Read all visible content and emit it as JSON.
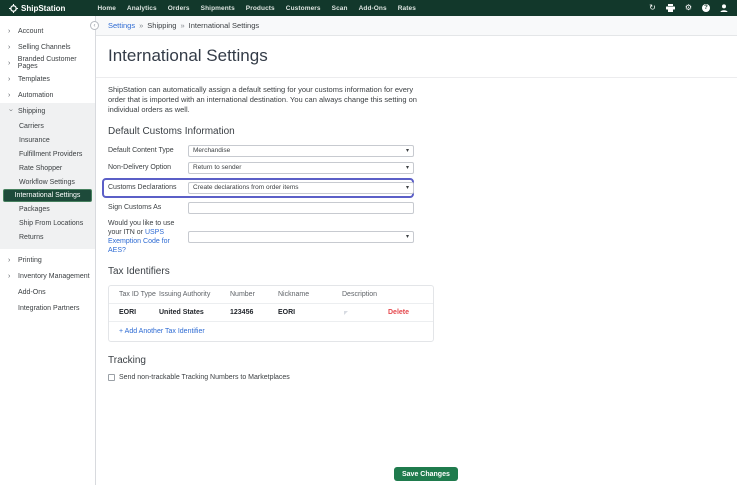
{
  "topbar": {
    "brand": "ShipStation",
    "nav": [
      "Home",
      "Analytics",
      "Orders",
      "Shipments",
      "Products",
      "Customers",
      "Scan",
      "Add-Ons",
      "Rates"
    ]
  },
  "breadcrumb": {
    "separator": "»",
    "settings": "Settings",
    "shipping": "Shipping",
    "current": "International Settings"
  },
  "sidebar": {
    "items_top": [
      "Account",
      "Selling Channels",
      "Branded Customer Pages",
      "Templates",
      "Automation"
    ],
    "shipping": {
      "label": "Shipping",
      "children": [
        "Carriers",
        "Insurance",
        "Fulfillment Providers",
        "Rate Shopper",
        "Workflow Settings",
        "International Settings",
        "Packages",
        "Ship From Locations",
        "Returns"
      ],
      "selected": "International Settings"
    },
    "items_bottom": [
      "Printing",
      "Inventory Management",
      "Add-Ons",
      "Integration Partners"
    ]
  },
  "page": {
    "title": "International Settings",
    "description": "ShipStation can automatically assign a default setting for your customs information for every order that is imported with an international destination. You can always change this setting on individual orders as well.",
    "customs_section": {
      "heading": "Default Customs Information",
      "content_type": {
        "label": "Default Content Type",
        "value": "Merchandise"
      },
      "non_delivery": {
        "label": "Non-Delivery Option",
        "value": "Return to sender"
      },
      "declarations": {
        "label": "Customs Declarations",
        "value": "Create declarations from order items"
      },
      "sign_as": {
        "label": "Sign Customs As",
        "value": ""
      },
      "itn": {
        "label_prefix": "Would you like to use your ITN or ",
        "link": "USPS Exemption Code for AES?",
        "value": ""
      }
    },
    "tax_section": {
      "heading": "Tax Identifiers",
      "headers": [
        "Tax ID Type",
        "Issuing Authority",
        "Number",
        "Nickname",
        "Description"
      ],
      "row": {
        "tax_id_type": "EORI",
        "issuing_authority": "United States",
        "number": "123456",
        "nickname": "EORI",
        "delete_label": "Delete"
      },
      "add_link": "+ Add Another Tax Identifier"
    },
    "tracking_section": {
      "heading": "Tracking",
      "checkbox_label": "Send non-trackable Tracking Numbers to Marketplaces"
    },
    "save_label": "Save Changes"
  },
  "colors": {
    "topbar_green": "#12382b",
    "selected_green": "#1d4a3a",
    "save_green": "#1f7b4d",
    "focus_purple": "#5b5fc7",
    "link_blue": "#2e6bd3",
    "delete_red": "#e5484d"
  }
}
